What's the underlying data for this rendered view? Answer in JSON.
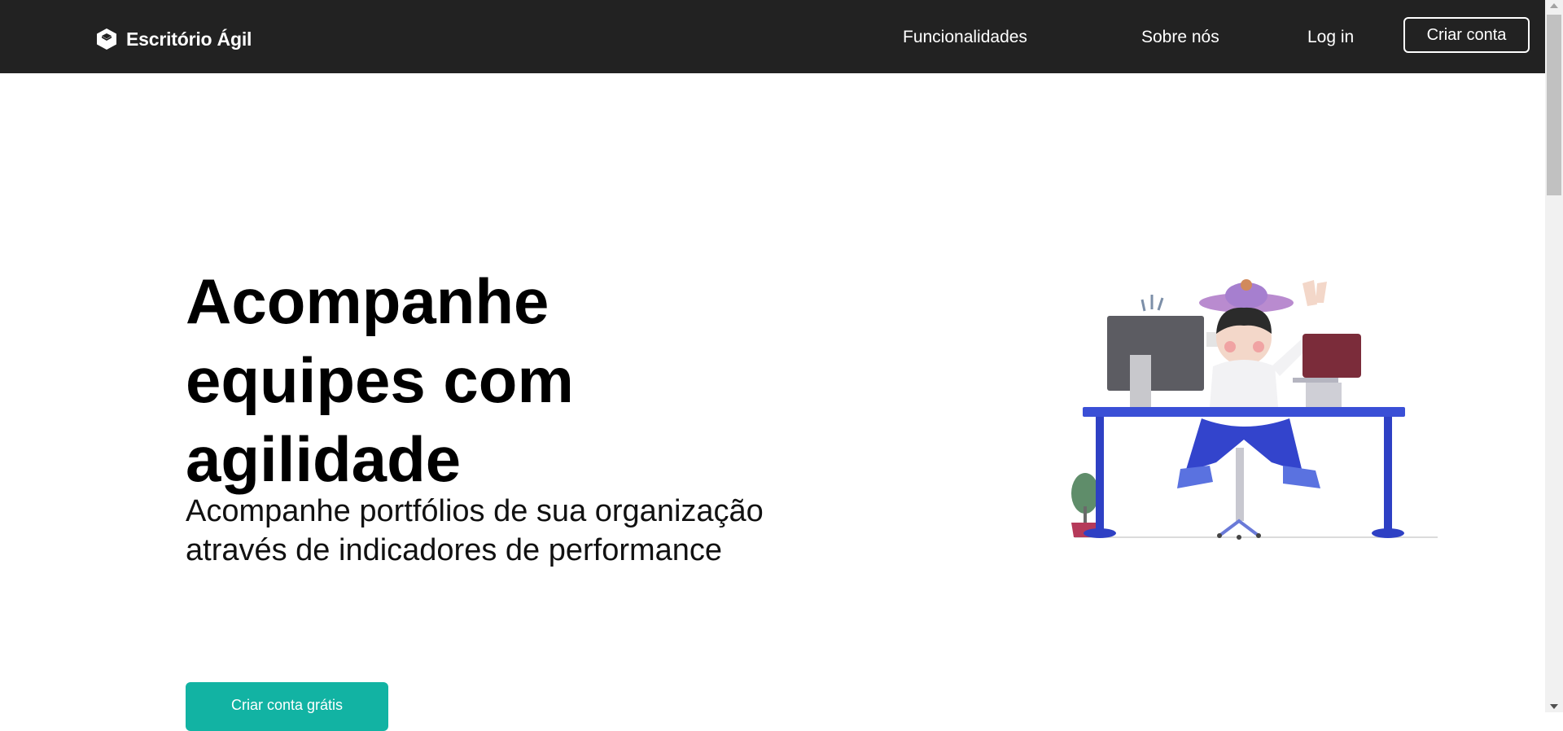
{
  "navbar": {
    "brand": "Escritório Ágil",
    "links": [
      "Funcionalidades",
      "Sobre nós",
      "Log in"
    ],
    "signup_button": "Criar conta"
  },
  "hero": {
    "title": "Acompanhe equipes com agilidade",
    "subtitle": "Acompanhe portfólios de sua organização através de indicadores de performance",
    "cta": "Criar conta grátis"
  },
  "colors": {
    "navbar_bg": "#222222",
    "cta_bg": "#12b3a3",
    "desk": "#3a4fd6"
  },
  "icons": {
    "brand": "cube-logo-icon"
  }
}
